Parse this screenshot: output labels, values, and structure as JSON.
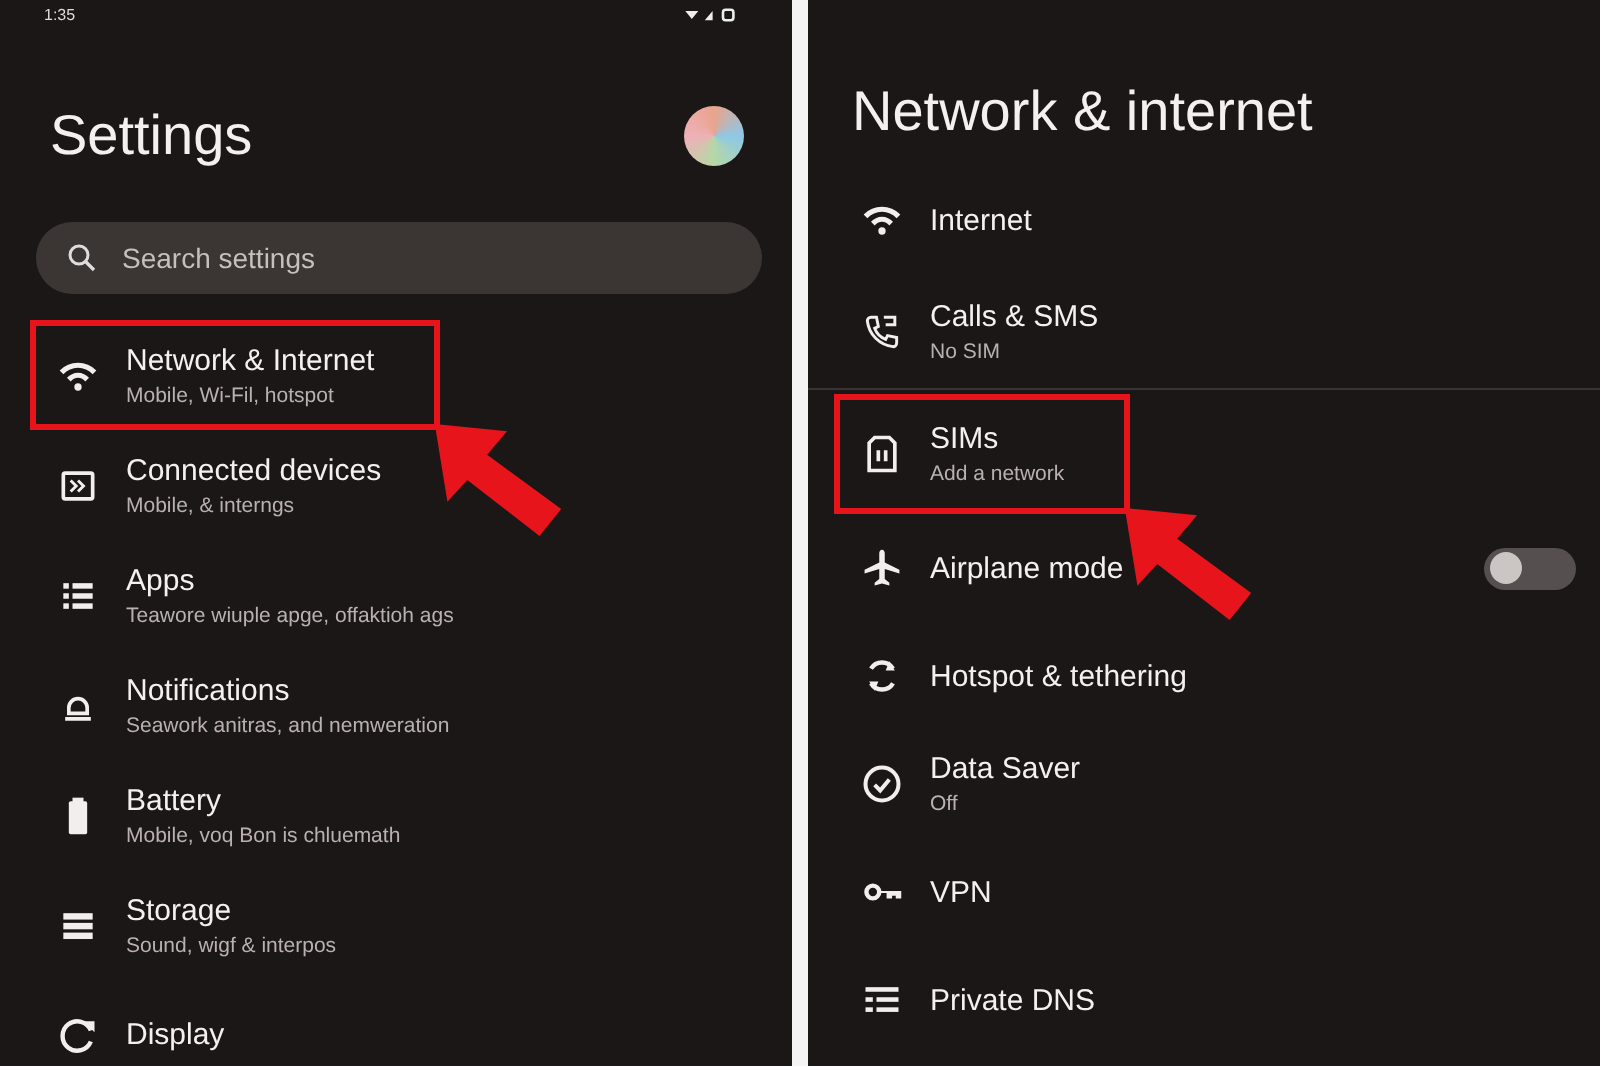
{
  "left_screen": {
    "status_bar": {
      "time": "1:35"
    },
    "title": "Settings",
    "search": {
      "placeholder": "Search settings"
    },
    "items": [
      {
        "kind": "wifi",
        "title": "Network & Internet",
        "subtitle": "Mobile, Wi-Fil, hotspot",
        "highlighted": true
      },
      {
        "kind": "devices",
        "title": "Connected devices",
        "subtitle": "Mobile, & interngs",
        "highlighted": false
      },
      {
        "kind": "apps",
        "title": "Apps",
        "subtitle": "Teawore wiuple apge, offaktioh ags",
        "highlighted": false
      },
      {
        "kind": "bell",
        "title": "Notifications",
        "subtitle": "Seawork anitras, and nemweration",
        "highlighted": false
      },
      {
        "kind": "battery",
        "title": "Battery",
        "subtitle": "Mobile, voq Bon is chluemath",
        "highlighted": false
      },
      {
        "kind": "storage",
        "title": "Storage",
        "subtitle": "Sound, wigf & interpos",
        "highlighted": false
      },
      {
        "kind": "display",
        "title": "Display",
        "highlighted": false
      }
    ]
  },
  "right_screen": {
    "title": "Network & internet",
    "sections": [
      {
        "items": [
          {
            "kind": "wifi",
            "title": "Internet",
            "highlighted": false
          },
          {
            "kind": "phone",
            "title": "Calls & SMS",
            "subtitle": "No SIM",
            "highlighted": false
          }
        ]
      },
      {
        "items": [
          {
            "kind": "sim",
            "title": "SIMs",
            "subtitle": "Add a network",
            "highlighted": true
          },
          {
            "kind": "airplane",
            "title": "Airplane mode",
            "highlighted": false,
            "toggle": {
              "on": false
            }
          },
          {
            "kind": "hotspot",
            "title": "Hotspot & tethering",
            "highlighted": false
          },
          {
            "kind": "check",
            "title": "Data Saver",
            "subtitle": "Off",
            "highlighted": false
          },
          {
            "kind": "key",
            "title": "VPN",
            "highlighted": false
          },
          {
            "kind": "dns",
            "title": "Private DNS",
            "highlighted": false
          }
        ]
      }
    ]
  }
}
